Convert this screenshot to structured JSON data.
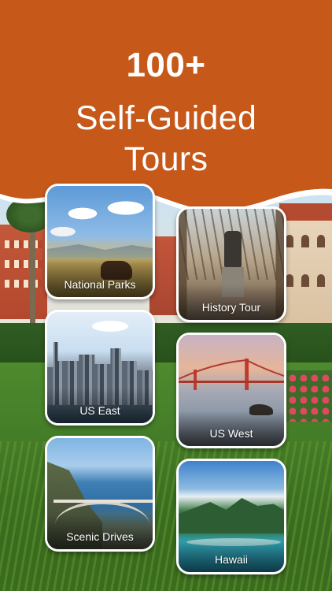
{
  "header": {
    "headline": "100+",
    "subheadline_line1": "Self-Guided",
    "subheadline_line2": "Tours"
  },
  "tours": [
    {
      "label": "National Parks"
    },
    {
      "label": "History Tour"
    },
    {
      "label": "US East"
    },
    {
      "label": "US West"
    },
    {
      "label": "Scenic Drives"
    },
    {
      "label": "Hawaii"
    }
  ],
  "colors": {
    "banner": "#c6581a",
    "text": "#ffffff",
    "card_border": "#ffffff"
  }
}
